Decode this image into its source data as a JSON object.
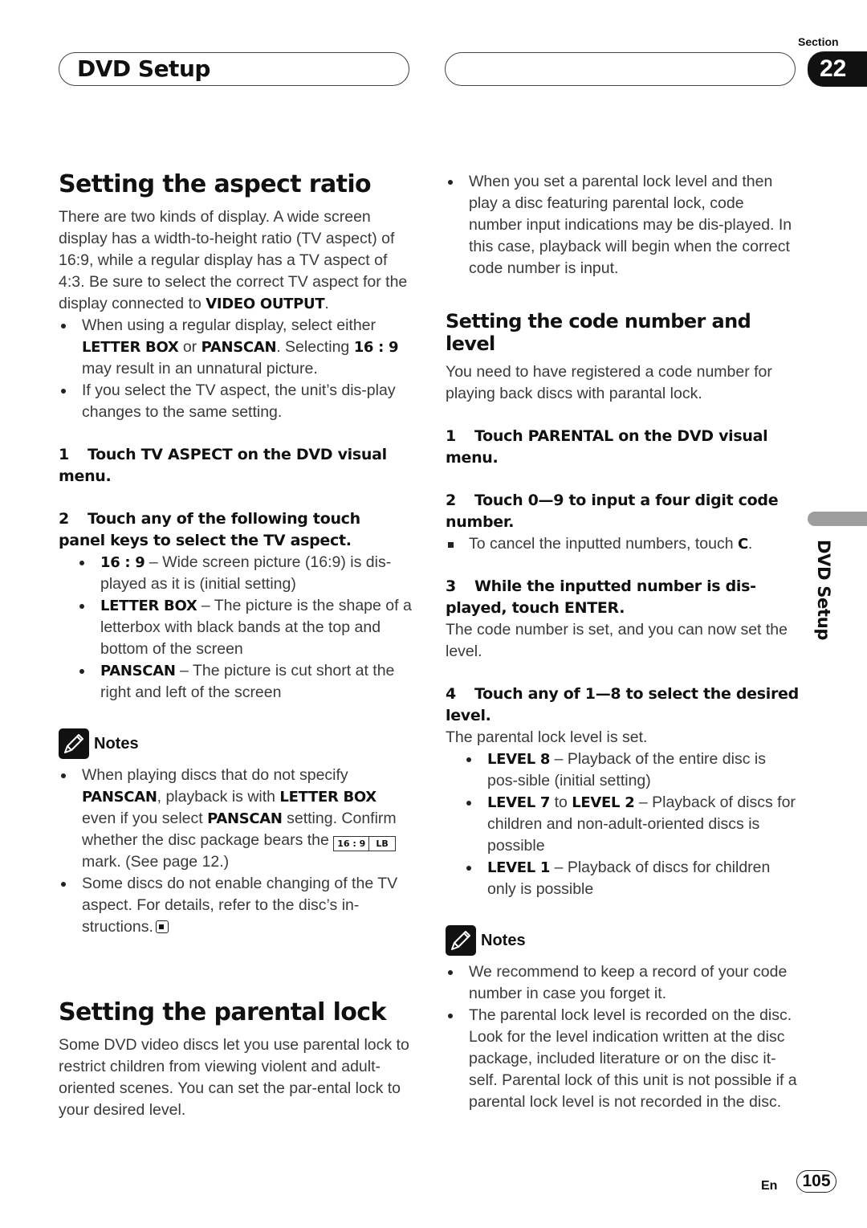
{
  "header": {
    "title": "DVD Setup",
    "section_label": "Section",
    "section_number": "22"
  },
  "left": {
    "aspect": {
      "heading": "Setting the aspect ratio",
      "intro": "There are two kinds of display. A wide screen display has a width-to-height ratio (TV aspect) of 16:9, while a regular display has a TV aspect of 4:3. Be sure to select the correct TV aspect for the display connected to ",
      "intro_bold": "VIDEO OUTPUT",
      "intro_end": ".",
      "bullets": [
        {
          "t1": "When using a regular display, select either ",
          "b1": "LETTER BOX",
          "t2": " or ",
          "b2": "PANSCAN",
          "t3": ". Selecting ",
          "b3": "16 : 9",
          "t4": " may result in an unnatural picture."
        },
        {
          "t1": "If you select the TV aspect, the unit’s dis-play changes to the same setting."
        }
      ],
      "step1": {
        "num": "1",
        "text": "Touch TV ASPECT on the DVD visual menu."
      },
      "step2": {
        "num": "2",
        "text": "Touch any of the following touch panel keys to select the TV aspect."
      },
      "options": [
        {
          "key": "16 : 9",
          "desc": " – Wide screen picture (16:9) is dis-played as it is (initial setting)"
        },
        {
          "key": "LETTER BOX",
          "desc": " – The picture is the shape of a letterbox with black bands at the top and bottom of the screen"
        },
        {
          "key": "PANSCAN",
          "desc": " – The picture is cut short at the right and left of the screen"
        }
      ]
    },
    "notes": {
      "label": "Notes",
      "n1": {
        "t1": "When playing discs that do not specify ",
        "b1": "PANSCAN",
        "t2": ", playback is with ",
        "b2": "LETTER BOX",
        "t3": " even if you select ",
        "b3": "PANSCAN",
        "t4": " setting. Confirm whether the disc package bears the ",
        "mark_a": "16 : 9",
        "mark_b": "LB",
        "t5": " mark. (See page 12.)"
      },
      "n2": "Some discs do not enable changing of the TV aspect. For details, refer to the disc’s in-structions."
    },
    "parental": {
      "heading": "Setting the parental lock",
      "intro": "Some DVD video discs let you use parental lock to restrict children from viewing violent and adult-oriented scenes. You can set the par-ental lock to your desired level."
    }
  },
  "right": {
    "bullet_top": "When you set a parental lock level and then play a disc featuring parental lock, code number input indications may be dis-played. In this case, playback will begin when the correct code number is input.",
    "code": {
      "heading": "Setting the code number and level",
      "intro": "You need to have registered a code number for playing back discs with parantal lock.",
      "step1": {
        "num": "1",
        "text": "Touch PARENTAL on the DVD visual menu."
      },
      "step2": {
        "num": "2",
        "text": "Touch 0—9 to input a four digit code number."
      },
      "step2_note": "To cancel the inputted numbers, touch ",
      "step2_note_bold": "C",
      "step2_note_end": ".",
      "step3": {
        "num": "3",
        "text": "While the inputted number is dis-played, touch ENTER."
      },
      "step3_result": "The code number is set, and you can now set the level.",
      "step4": {
        "num": "4",
        "text": "Touch any of 1—8 to select the desired level."
      },
      "step4_result": "The parental lock level is set.",
      "levels": [
        {
          "b1": "LEVEL 8",
          "t1": " – Playback of the entire disc is pos-sible (initial setting)"
        },
        {
          "b1": "LEVEL 7",
          "t1": " to ",
          "b2": "LEVEL 2",
          "t2": " – Playback of discs for children and non-adult-oriented discs is possible"
        },
        {
          "b1": "LEVEL 1",
          "t1": " – Playback of discs for children only is possible"
        }
      ]
    },
    "notes": {
      "label": "Notes",
      "n1": "We recommend to keep a record of your code number in case you forget it.",
      "n2": "The parental lock level is recorded on the disc. Look for the level indication written at the disc package, included literature or on the disc it-self. Parental lock of this unit is not possible if a parental lock level is not recorded in the disc."
    }
  },
  "side_tab": "DVD Setup",
  "footer": {
    "lang": "En",
    "page": "105"
  }
}
